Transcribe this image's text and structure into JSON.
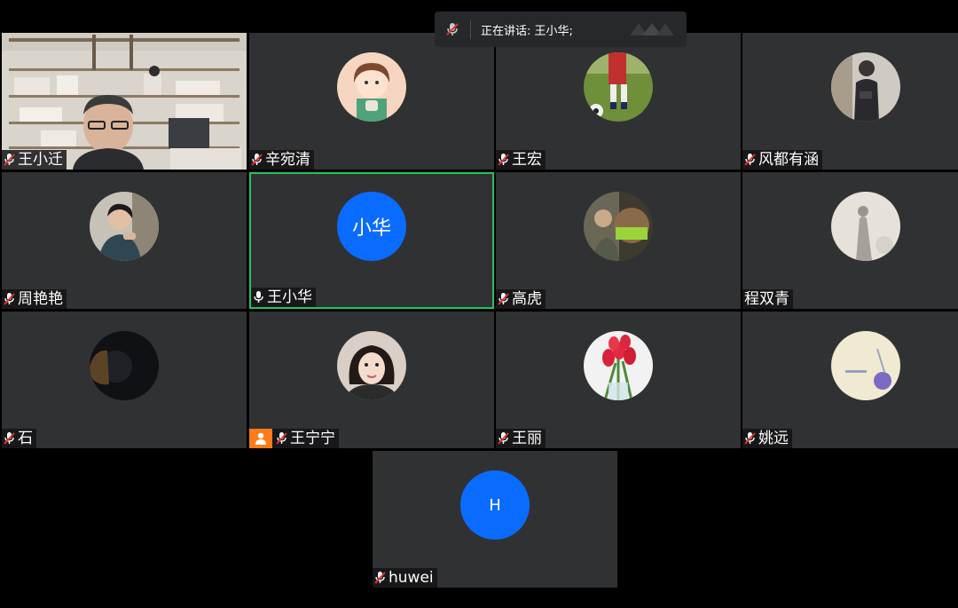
{
  "speaker_bar": {
    "status": "正在讲话: 王小华;",
    "icon": "mic-muted-icon",
    "logo": "brand-logo-icon"
  },
  "participants": [
    {
      "name": "王小迁",
      "muted": true,
      "type": "video"
    },
    {
      "name": "辛宛清",
      "muted": true,
      "type": "photo"
    },
    {
      "name": "王宏",
      "muted": true,
      "type": "photo"
    },
    {
      "name": "风都有涵",
      "muted": true,
      "type": "photo"
    },
    {
      "name": "周艳艳",
      "muted": true,
      "type": "photo"
    },
    {
      "name": "王小华",
      "muted": false,
      "type": "letter",
      "initials": "小华",
      "active": true
    },
    {
      "name": "高虎",
      "muted": true,
      "type": "photo"
    },
    {
      "name": "程双青",
      "muted": null,
      "type": "photo"
    },
    {
      "name": "石",
      "muted": true,
      "type": "photo"
    },
    {
      "name": "王宁宁",
      "muted": true,
      "type": "photo",
      "host": true
    },
    {
      "name": "王丽",
      "muted": true,
      "type": "photo"
    },
    {
      "name": "姚远",
      "muted": true,
      "type": "photo"
    },
    {
      "name": "huwei",
      "muted": true,
      "type": "letter",
      "initials": "H"
    }
  ],
  "colors": {
    "tile_bg": "#303133",
    "active_border": "#22c55e",
    "letter_avatar": "#0a6cff",
    "host_badge": "#ff7a18",
    "muted_red": "#e03131"
  }
}
